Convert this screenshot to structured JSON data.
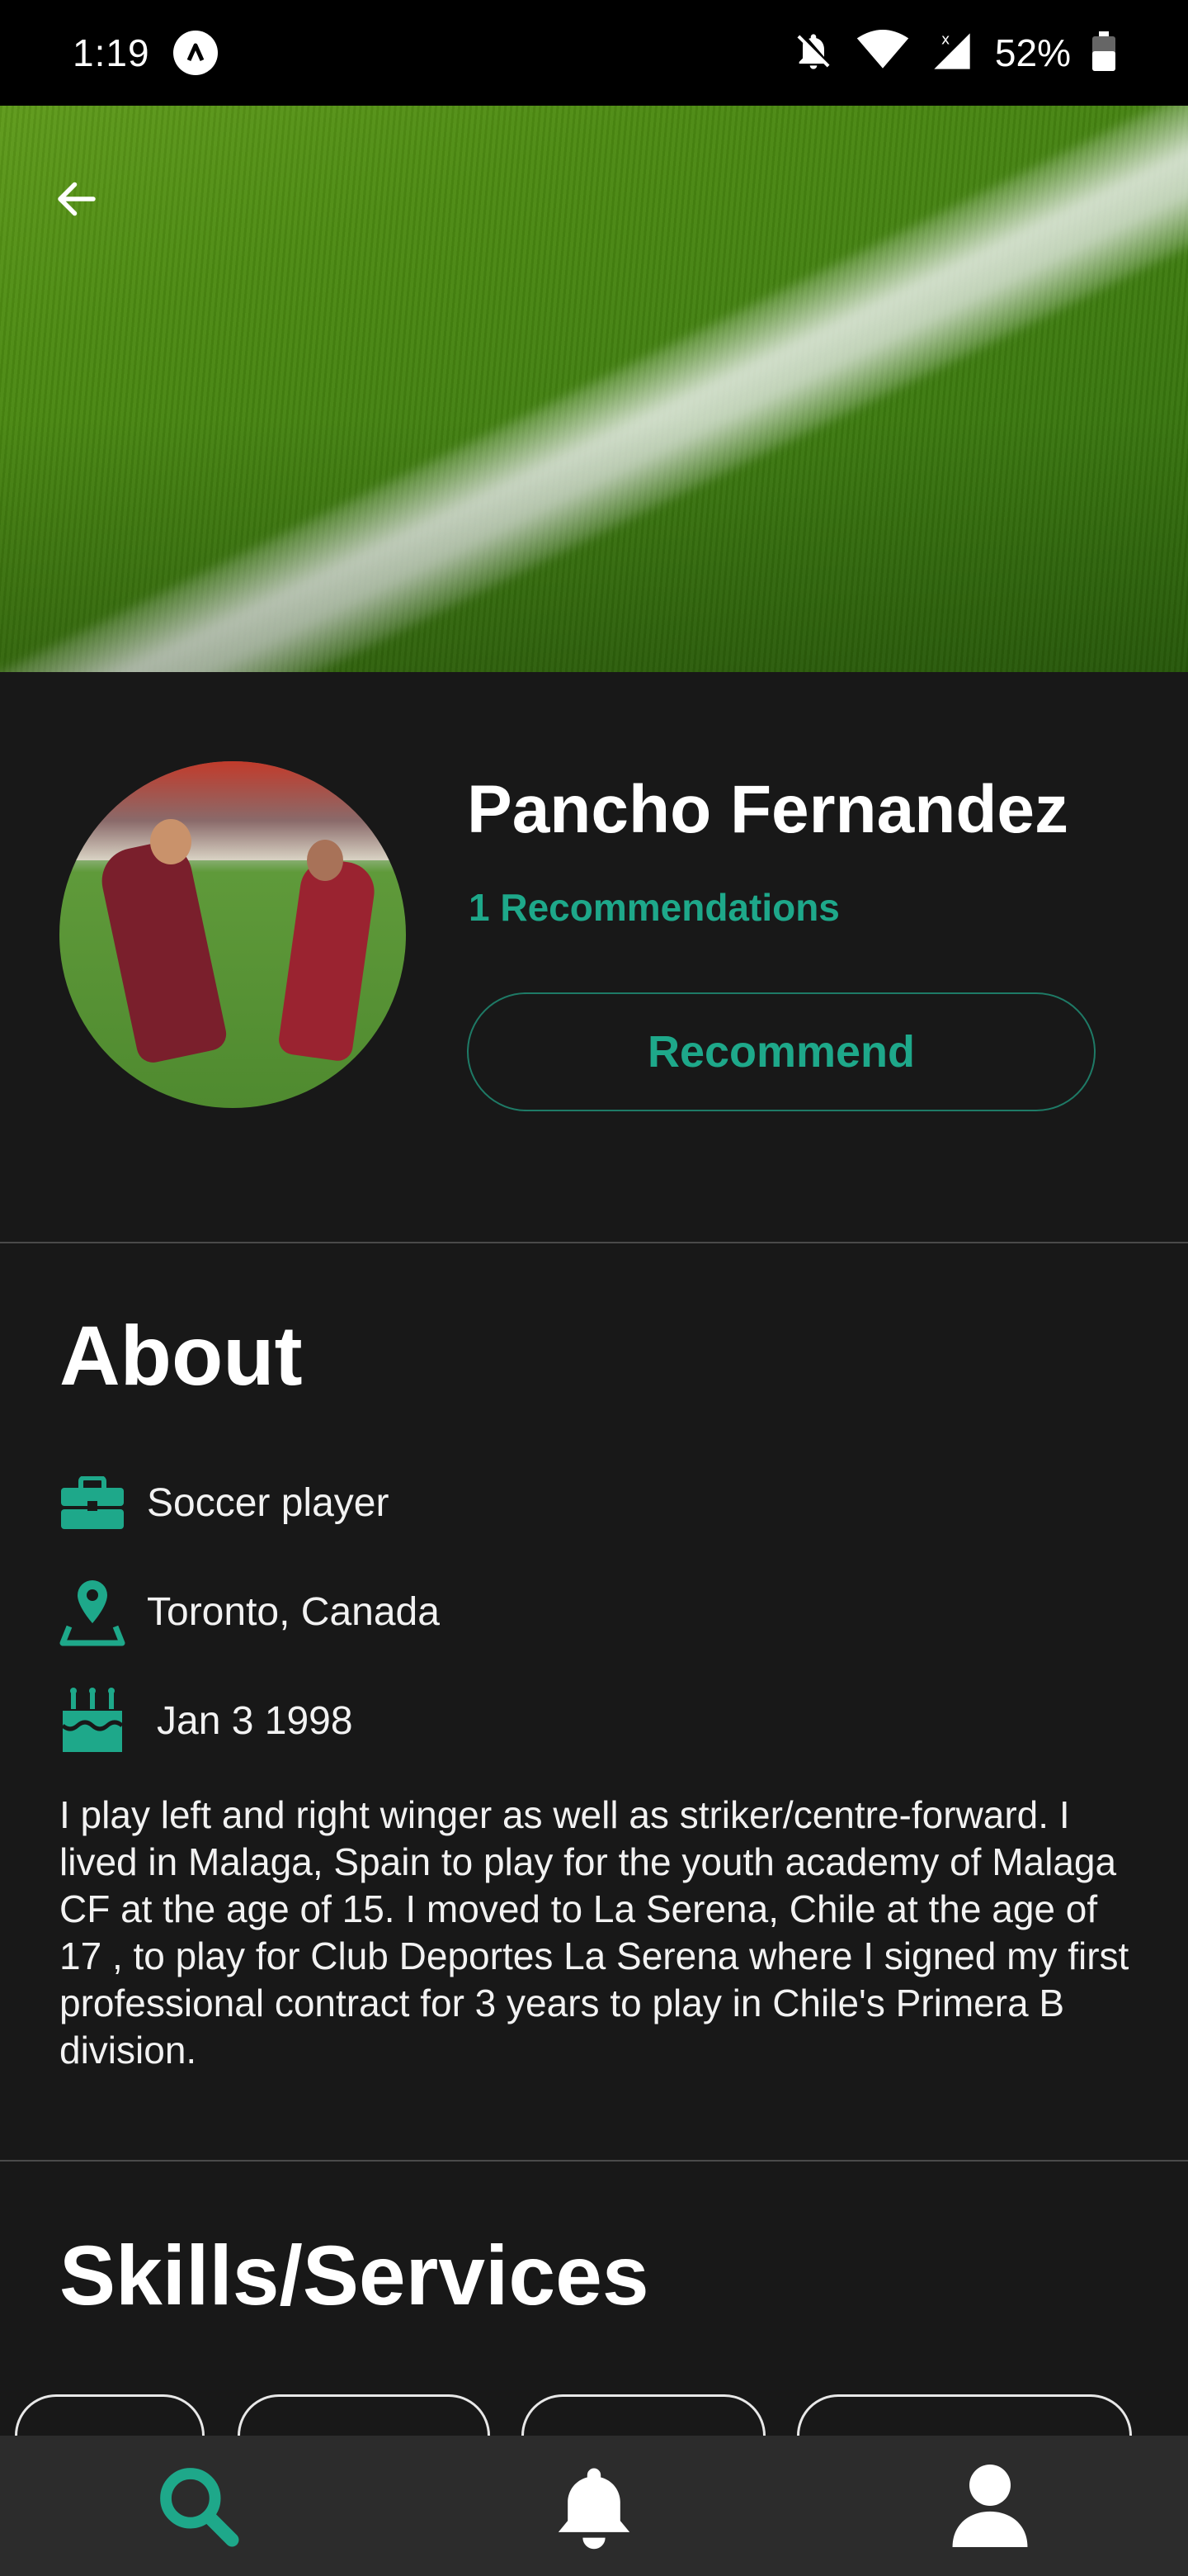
{
  "status_bar": {
    "time": "1:19",
    "app_icon": "arc-logo-icon",
    "icons": [
      "bell-off-icon",
      "wifi-icon",
      "cell-signal-icon",
      "battery-icon"
    ],
    "battery": "52%"
  },
  "header": {
    "back_icon": "back-arrow-icon",
    "image": "soccer-field-grass-photo"
  },
  "profile": {
    "name": "Pancho Fernandez",
    "recommendations": "1 Recommendations",
    "recommend_button": "Recommend",
    "avatar": "soccer-players-celebrating-photo"
  },
  "about": {
    "title": "About",
    "occupation": "Soccer player",
    "location": "Toronto, Canada",
    "birthday": "Jan 3 1998",
    "bio": "I play left and right winger as well as striker/centre-forward. I lived in Malaga, Spain to play for the youth academy of Malaga CF at the age of 15.  I moved to La Serena, Chile at the age of 17 , to play for Club Deportes La Serena where I signed my first professional contract for 3 years to play in Chile's Primera B division."
  },
  "skills": {
    "title": "Skills/Services"
  },
  "bottom_nav": {
    "items": [
      "search-icon",
      "bell-icon",
      "user-icon"
    ],
    "active": "search-icon"
  },
  "colors": {
    "accent": "#1ea88a",
    "background": "#181818",
    "nav_background": "#2c2c2c"
  }
}
